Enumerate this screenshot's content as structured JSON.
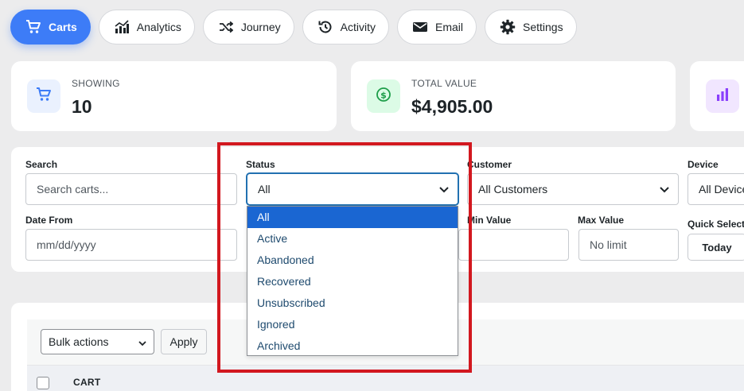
{
  "tabs": [
    {
      "label": "Carts",
      "icon": "cart-icon",
      "active": true
    },
    {
      "label": "Analytics",
      "icon": "chart-icon",
      "active": false
    },
    {
      "label": "Journey",
      "icon": "shuffle-icon",
      "active": false
    },
    {
      "label": "Activity",
      "icon": "history-icon",
      "active": false
    },
    {
      "label": "Email",
      "icon": "envelope-icon",
      "active": false
    },
    {
      "label": "Settings",
      "icon": "gear-icon",
      "active": false
    }
  ],
  "stats": [
    {
      "label": "SHOWING",
      "value": "10",
      "icon": "cart-icon",
      "color": "#3d7cf7",
      "bg": "#eaf1fe"
    },
    {
      "label": "TOTAL VALUE",
      "value": "$4,905.00",
      "icon": "dollar-icon",
      "color": "#1e9e4a",
      "bg": "#dcfbe6"
    },
    {
      "label": "",
      "value": "",
      "icon": "bar-chart-icon",
      "color": "#8a3ffc",
      "bg": "#f1e6ff"
    }
  ],
  "filters": {
    "search_label": "Search",
    "search_placeholder": "Search carts...",
    "status_label": "Status",
    "status_value": "All",
    "customer_label": "Customer",
    "customer_value": "All Customers",
    "device_label": "Device",
    "device_value": "All Devices",
    "date_from_label": "Date From",
    "date_from_placeholder": "mm/dd/yyyy",
    "min_value_label": "Min Value",
    "max_value_label": "Max Value",
    "max_value_placeholder": "No limit",
    "quick_select_label": "Quick Select",
    "today_label": "Today"
  },
  "status_options": [
    "All",
    "Active",
    "Abandoned",
    "Recovered",
    "Unsubscribed",
    "Ignored",
    "Archived"
  ],
  "status_selected_index": 0,
  "table": {
    "bulk_actions_label": "Bulk actions",
    "apply_label": "Apply",
    "col_cart": "CART"
  },
  "colors": {
    "accent": "#3d7cf7",
    "highlight": "#d2181f",
    "option_highlight": "#1a66d2"
  }
}
